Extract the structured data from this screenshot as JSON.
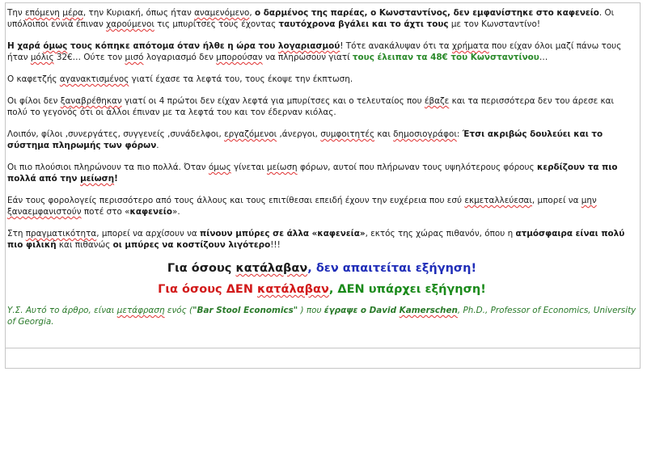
{
  "paragraphs": {
    "p1": {
      "a": "Την ",
      "b": "επόμενη",
      "c": " ",
      "d": "μέρα",
      "e": ", την Κυριακή, όπως ήταν ",
      "f": "αναμενόμενο",
      "g": ", ",
      "h": "ο δαρμένος της παρέας, ο Κωνσταντίνος, δεν εμφανίστηκε στο καφενείο",
      "i": ". Οι υπόλοιποι εννιά έπιναν ",
      "j": "χαρούμενοι",
      "k": " τις μπυρίτσες τους έχοντας ",
      "l": "ταυτόχρονα βγάλει και το άχτι τους",
      "m": " με τον Κωνσταντίνο!"
    },
    "p2": {
      "a": "Η χαρά ",
      "b": "όμως",
      "c": " τους κόπηκε απότομα όταν ήλθε η ώρα του ",
      "d": "λογαριασμού",
      "e": "! Τότε ανακάλυψαν ότι τα ",
      "f": "χρήματα",
      "g": " που είχαν όλοι μαζί πάνω τους ήταν ",
      "h": "μόλις",
      "i": " 32€… Ούτε τον ",
      "j": "μισό",
      "k": " λογαριασμό δεν ",
      "l": "μπορούσαν",
      "m": " να πληρώσουν γιατί ",
      "n": "τους έλειπαν τα 48€ του Κωνσταντίνου",
      "o": "…"
    },
    "p3": {
      "a": "Ο καφετζής ",
      "b": "αγανακτισμένος",
      "c": " γιατί έχασε τα λεφτά του, τους έκοψε την έκπτωση."
    },
    "p4": {
      "a": "Οι φίλοι δεν ",
      "b": "ξαναβρέθηκαν",
      "c": " γιατί οι 4 πρώτοι δεν είχαν λεφτά για μπυρίτσες και ο τελευταίος που ",
      "d": "έβαζε",
      "e": " και τα περισσότερα δεν του άρεσε και πολύ το γεγονός ότι οι άλλοι έπιναν με τα λεφτά του και τον έδερναν κιόλας."
    },
    "p5": {
      "a": "Λοιπόν, φίλοι ,συνεργάτες, συγγενείς ,συνάδελφοι, ",
      "b": "εργαζόμενοι",
      "c": " ,άνεργοι, ",
      "d": "συμφοιτητές",
      "e": " και ",
      "f": "δημοσιογράφοι",
      "g": ": ",
      "h": "Έτσι ακριβώς δουλεύει και το σύστημα πληρωμής των φόρων",
      "i": "."
    },
    "p6": {
      "a": "Οι πιο πλούσιοι πληρώνουν τα πιο πολλά. Όταν ",
      "b": "όμως",
      "c": " γίνεται ",
      "d": "μείωση",
      "e": " φόρων, αυτοί που πλήρωναν τους υψηλότερους φόρους ",
      "f": "κερδίζουν τα πιο πολλά από την ",
      "g": "μείωση",
      "h": "!"
    },
    "p7": {
      "a": "Εάν τους φορολογείς περισσότερο από τους άλλους και τους επιτίθεσαι επειδή έχουν την ευχέρεια που εσύ ",
      "b": "εκμεταλλεύεσαι",
      "c": ", μπορεί να ",
      "d": "μην",
      "e": " ",
      "f": "ξαναεμφανιστούν",
      "g": " ποτέ στο «",
      "h": "καφενείο",
      "i": "»."
    },
    "p8": {
      "a": "Στη ",
      "b": "πραγματικότητα",
      "c": ", μπορεί να αρχίσουν να ",
      "d": "πίνουν μπύρες σε άλλα «καφενεία»",
      "e": ", εκτός της χώρας πιθανόν, όπου η ",
      "f": "ατμόσφαιρα είναι πολύ πιο φιλική",
      "g": " και πιθανώς ",
      "h": "οι μπύρες να κοστίζουν λιγότερο",
      "i": "!!!"
    }
  },
  "headline1": {
    "a": "Για όσους ",
    "b": "κατάλαβαν",
    "c": ", δεν απαιτείται εξήγηση!"
  },
  "headline2": {
    "a": "Για όσους ΔΕΝ ",
    "b": "κατάλαβαν",
    "c": ", ΔΕΝ υπάρχει εξήγηση!"
  },
  "footnote": {
    "a": "Υ.Σ. Αυτό το άρθρο, είναι ",
    "b": "μετάφραση",
    "c": " ενός (",
    "d": "\"Bar Stool Economics\"",
    "e": " ) που ",
    "f": "έγραψε ο David ",
    "g": "Kamerschen",
    "h": ", Ph.D., Professor of Economics, University of Georgia."
  },
  "colors": {
    "green": "#2a8a2a",
    "blue": "#1f2db8",
    "red": "#d21a1a",
    "spellcheck": "#e03030"
  }
}
